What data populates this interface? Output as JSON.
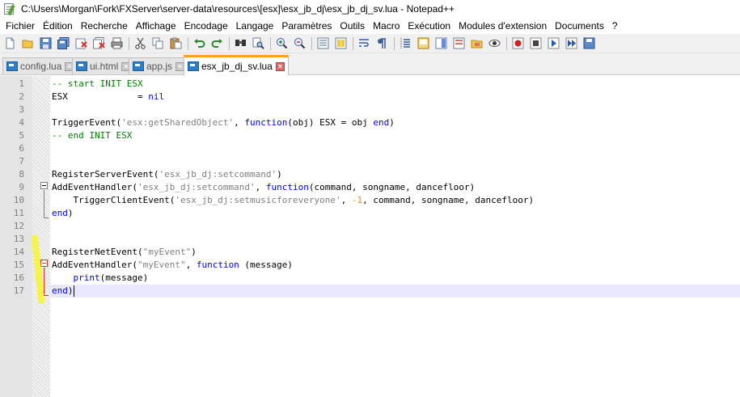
{
  "window": {
    "title": "C:\\Users\\Morgan\\Fork\\FXServer\\server-data\\resources\\[esx]\\esx_jb_dj\\esx_jb_dj_sv.lua - Notepad++"
  },
  "menu": [
    "Fichier",
    "Édition",
    "Recherche",
    "Affichage",
    "Encodage",
    "Langage",
    "Paramètres",
    "Outils",
    "Macro",
    "Exécution",
    "Modules d'extension",
    "Documents",
    "?"
  ],
  "toolbar": {
    "icons": [
      "new-file-icon",
      "open-file-icon",
      "save-icon",
      "save-all-icon",
      "close-icon",
      "close-all-icon",
      "print-icon",
      "cut-icon",
      "copy-icon",
      "paste-icon",
      "undo-icon",
      "redo-icon",
      "find-icon",
      "replace-icon",
      "zoom-in-icon",
      "zoom-out-icon",
      "sync-v-icon",
      "sync-h-icon",
      "word-wrap-icon",
      "show-all-chars-icon",
      "indent-guide-icon",
      "udl-icon",
      "doc-map-icon",
      "function-list-icon",
      "folder-workspace-icon",
      "monitoring-icon",
      "record-macro-icon",
      "stop-macro-icon",
      "play-macro-icon",
      "play-multiple-icon",
      "save-macro-icon"
    ]
  },
  "tabs": [
    {
      "label": "config.lua",
      "active": false
    },
    {
      "label": "ui.html",
      "active": false
    },
    {
      "label": "app.js",
      "active": false
    },
    {
      "label": "esx_jb_dj_sv.lua",
      "active": true
    }
  ],
  "colors": {
    "comment": "#008000",
    "string": "#808080",
    "keyword": "#0000ff",
    "number": "#ff8000",
    "active_tab_accent": "#f9a11b",
    "current_line": "#e8e8ff"
  },
  "editor": {
    "current_line": 17,
    "lines": [
      {
        "n": "1",
        "tokens": [
          {
            "t": "-- start INIT ESX",
            "c": "comment"
          }
        ]
      },
      {
        "n": "2",
        "tokens": [
          {
            "t": "ESX             = ",
            "c": ""
          },
          {
            "t": "nil",
            "c": "keyword"
          }
        ]
      },
      {
        "n": "3",
        "tokens": []
      },
      {
        "n": "4",
        "tokens": [
          {
            "t": "TriggerEvent(",
            "c": ""
          },
          {
            "t": "'esx:getSharedObject'",
            "c": "string"
          },
          {
            "t": ", ",
            "c": ""
          },
          {
            "t": "function",
            "c": "keyword"
          },
          {
            "t": "(obj) ESX = obj ",
            "c": ""
          },
          {
            "t": "end",
            "c": "keyword"
          },
          {
            "t": ")",
            "c": ""
          }
        ]
      },
      {
        "n": "5",
        "tokens": [
          {
            "t": "-- end INIT ESX",
            "c": "comment"
          }
        ]
      },
      {
        "n": "6",
        "tokens": []
      },
      {
        "n": "7",
        "tokens": []
      },
      {
        "n": "8",
        "tokens": [
          {
            "t": "RegisterServerEvent(",
            "c": ""
          },
          {
            "t": "'esx_jb_dj:setcommand'",
            "c": "string"
          },
          {
            "t": ")",
            "c": ""
          }
        ]
      },
      {
        "n": "9",
        "tokens": [
          {
            "t": "AddEventHandler(",
            "c": ""
          },
          {
            "t": "'esx_jb_dj:setcommand'",
            "c": "string"
          },
          {
            "t": ", ",
            "c": ""
          },
          {
            "t": "function",
            "c": "keyword"
          },
          {
            "t": "(command, songname, dancefloor)",
            "c": ""
          }
        ]
      },
      {
        "n": "10",
        "tokens": [
          {
            "t": "    TriggerClientEvent(",
            "c": ""
          },
          {
            "t": "'esx_jb_dj:setmusicforeveryone'",
            "c": "string"
          },
          {
            "t": ", ",
            "c": ""
          },
          {
            "t": "-1",
            "c": "number"
          },
          {
            "t": ", command, songname, dancefloor)",
            "c": ""
          }
        ]
      },
      {
        "n": "11",
        "tokens": [
          {
            "t": "end",
            "c": "keyword"
          },
          {
            "t": ")",
            "c": ""
          }
        ]
      },
      {
        "n": "12",
        "tokens": []
      },
      {
        "n": "13",
        "tokens": []
      },
      {
        "n": "14",
        "tokens": [
          {
            "t": "RegisterNetEvent(",
            "c": ""
          },
          {
            "t": "\"myEvent\"",
            "c": "string"
          },
          {
            "t": ")",
            "c": ""
          }
        ]
      },
      {
        "n": "15",
        "tokens": [
          {
            "t": "AddEventHandler(",
            "c": ""
          },
          {
            "t": "\"myEvent\"",
            "c": "string"
          },
          {
            "t": ", ",
            "c": ""
          },
          {
            "t": "function",
            "c": "keyword"
          },
          {
            "t": " (message)",
            "c": ""
          }
        ]
      },
      {
        "n": "16",
        "tokens": [
          {
            "t": "    ",
            "c": ""
          },
          {
            "t": "print",
            "c": "keyword"
          },
          {
            "t": "(message)",
            "c": ""
          }
        ]
      },
      {
        "n": "17",
        "tokens": [
          {
            "t": "end",
            "c": "keyword"
          },
          {
            "t": ")",
            "c": ""
          }
        ]
      }
    ]
  }
}
